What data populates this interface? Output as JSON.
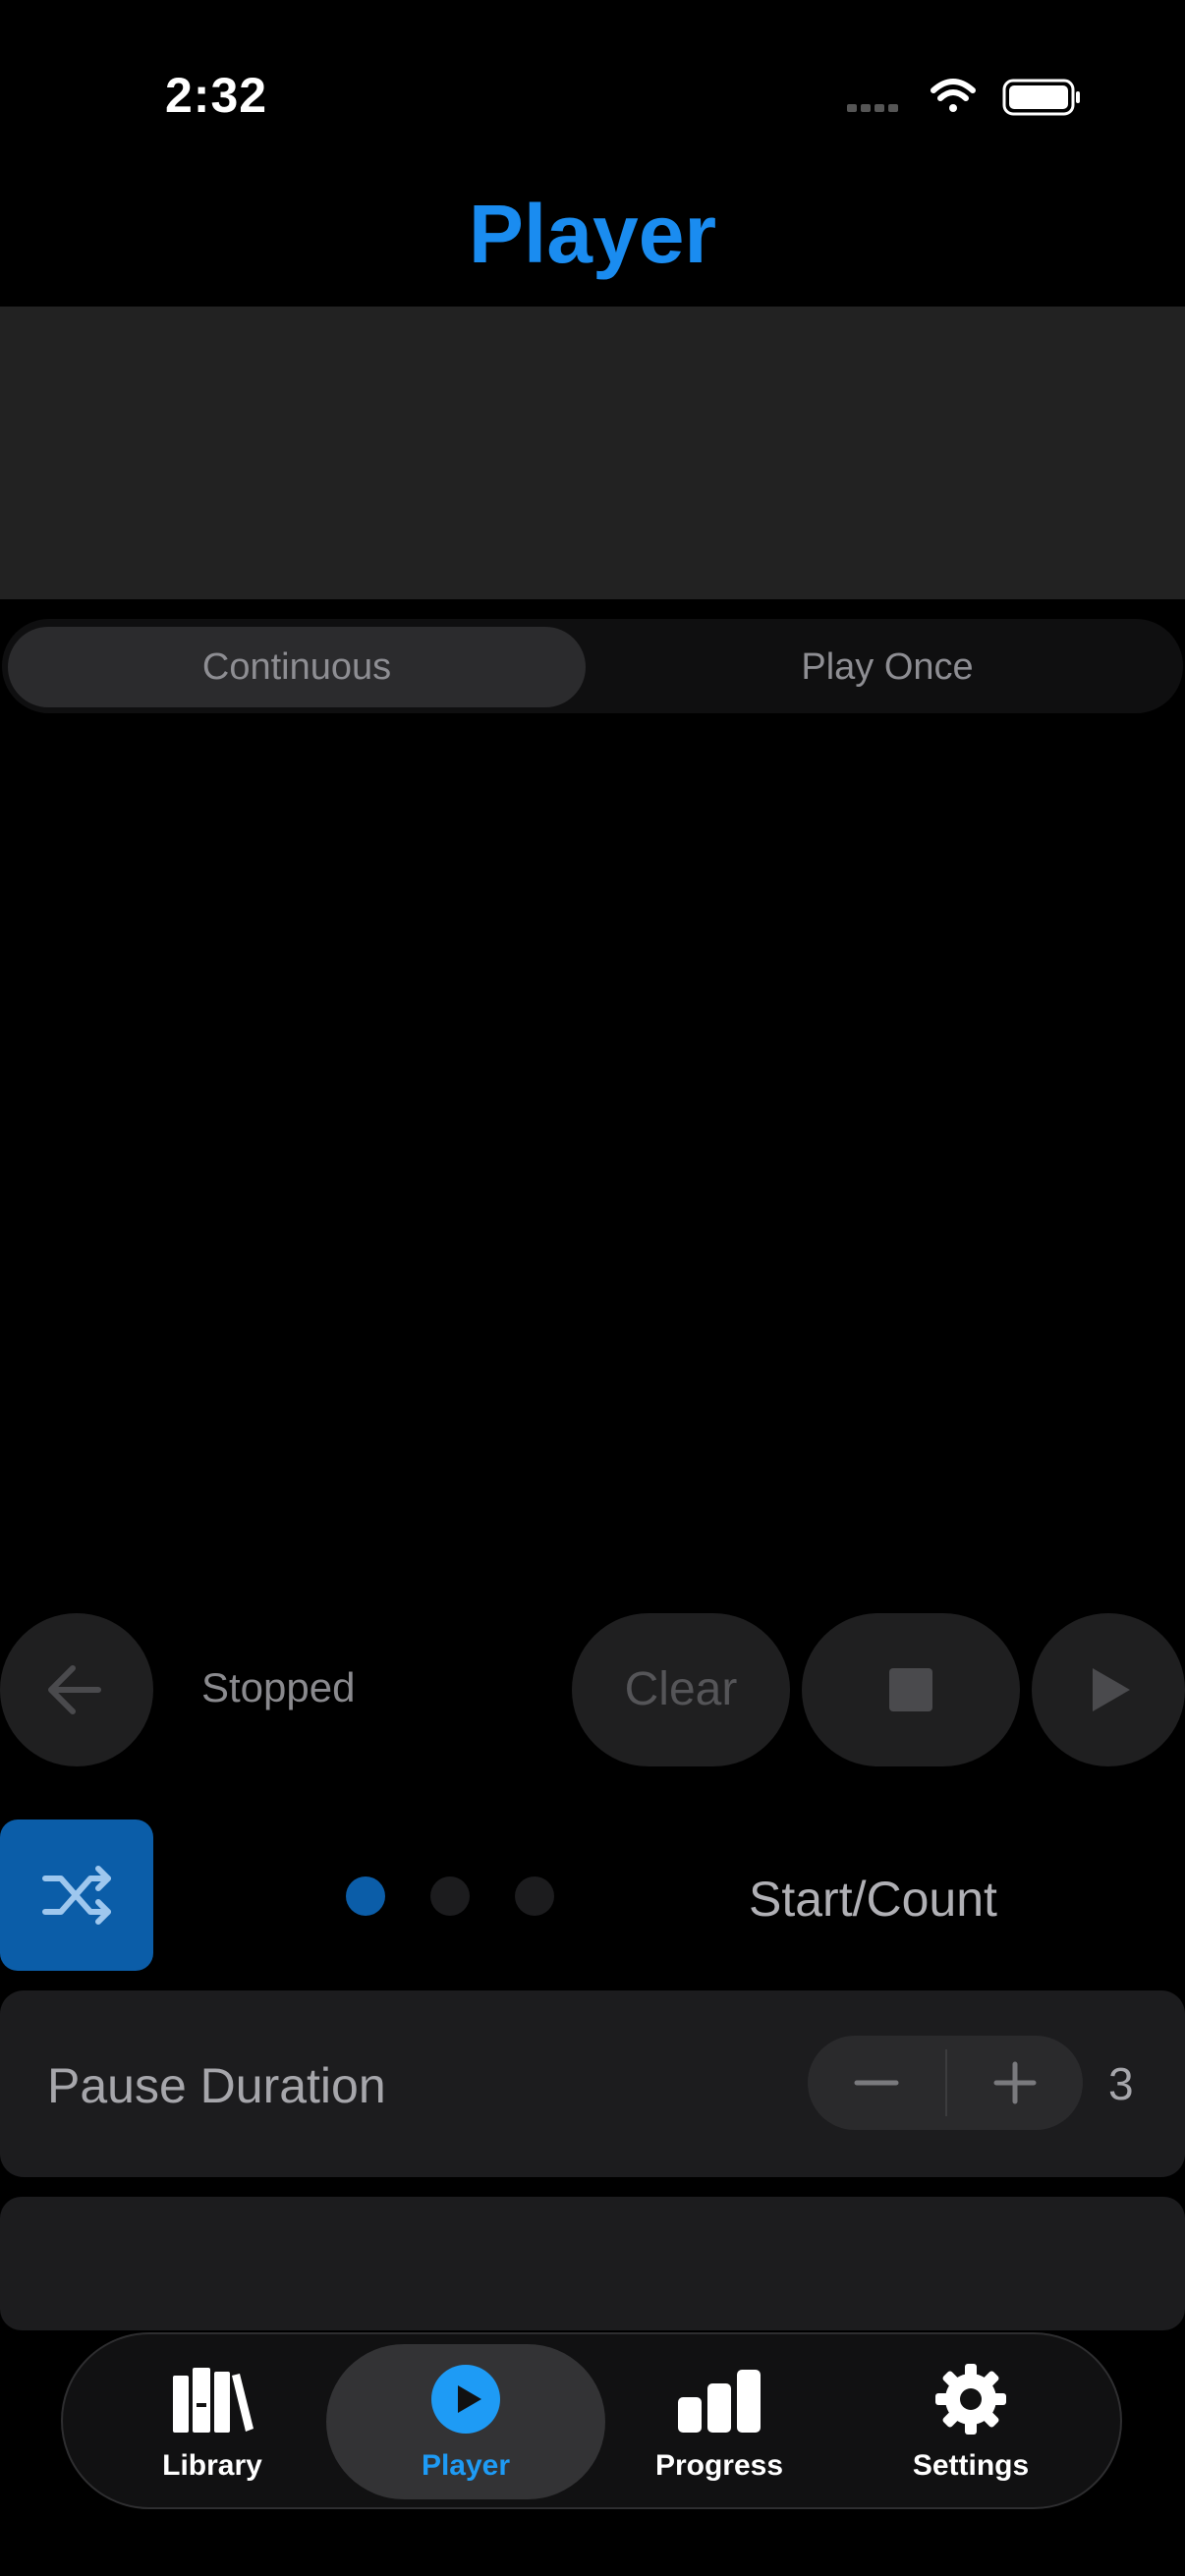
{
  "status_bar": {
    "time": "2:32"
  },
  "header": {
    "title": "Player"
  },
  "mode": {
    "options": [
      "Continuous",
      "Play Once"
    ],
    "selected": "Continuous"
  },
  "controls": {
    "status": "Stopped",
    "clear_label": "Clear"
  },
  "shuffle_row": {
    "page_count": 3,
    "current_page": 1,
    "label": "Start/Count"
  },
  "pause": {
    "label": "Pause Duration",
    "value": "3"
  },
  "tabs": [
    {
      "label": "Library",
      "icon": "books-icon",
      "active": false
    },
    {
      "label": "Player",
      "icon": "play-circle-icon",
      "active": true
    },
    {
      "label": "Progress",
      "icon": "bar-chart-icon",
      "active": false
    },
    {
      "label": "Settings",
      "icon": "gear-icon",
      "active": false
    }
  ],
  "colors": {
    "accent": "#1a8cf0",
    "active_tab": "#1a8cf0",
    "shuffle_bg": "#0b5da8",
    "inactive_dot": "#1c1c1e"
  }
}
